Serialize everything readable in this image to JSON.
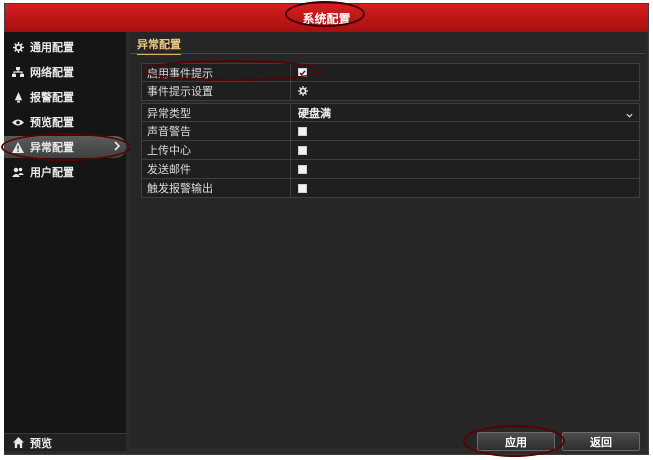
{
  "window": {
    "title": "系统配置"
  },
  "sidebar": {
    "items": [
      {
        "label": "通用配置",
        "icon": "gear-icon"
      },
      {
        "label": "网络配置",
        "icon": "network-icon"
      },
      {
        "label": "报警配置",
        "icon": "alarm-icon"
      },
      {
        "label": "预览配置",
        "icon": "eye-icon"
      },
      {
        "label": "异常配置",
        "icon": "warning-icon",
        "active": true
      },
      {
        "label": "用户配置",
        "icon": "users-icon"
      }
    ],
    "preview_button": {
      "label": "预览",
      "icon": "home-icon"
    }
  },
  "main": {
    "tab": "异常配置",
    "group1": [
      {
        "label": "启用事件提示",
        "type": "checkbox",
        "checked": true
      },
      {
        "label": "事件提示设置",
        "type": "gear",
        "icon": "gear-icon"
      }
    ],
    "group2": [
      {
        "label": "异常类型",
        "type": "select",
        "value": "硬盘满"
      },
      {
        "label": "声音警告",
        "type": "checkbox",
        "checked": false
      },
      {
        "label": "上传中心",
        "type": "checkbox",
        "checked": false
      },
      {
        "label": "发送邮件",
        "type": "checkbox",
        "checked": false
      },
      {
        "label": "触发报警输出",
        "type": "checkbox",
        "checked": false
      }
    ]
  },
  "footer": {
    "apply_label": "应用",
    "back_label": "返回"
  },
  "colors": {
    "titlebar": "#c81818",
    "tab_accent": "#d8b865",
    "panel": "#262626",
    "sidebar": "#151515"
  }
}
